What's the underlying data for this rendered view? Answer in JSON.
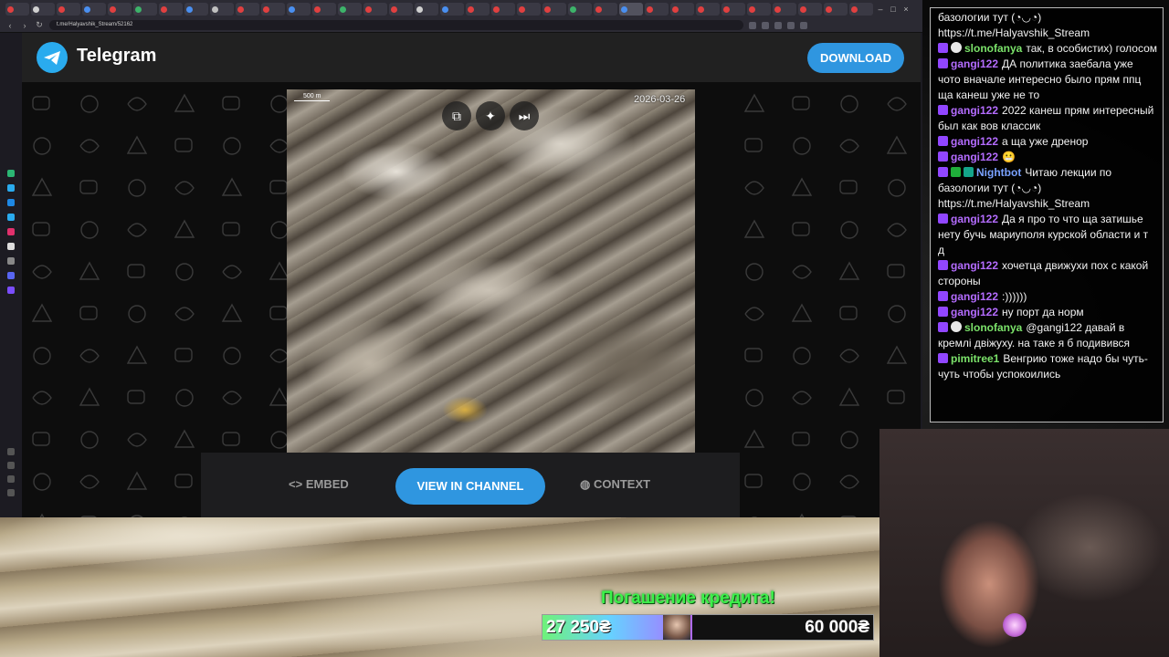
{
  "browser": {
    "url": "t.me/Halyavshik_Stream/52162",
    "tab_colors": [
      "#e04040",
      "#d0d0d0",
      "#e04040",
      "#4a8ff0",
      "#e04040",
      "#3db36a",
      "#e04040",
      "#4a8ff0",
      "#c0c0c0",
      "#e04040",
      "#e04040",
      "#4a8ff0",
      "#e04040",
      "#3db36a",
      "#e04040",
      "#e04040",
      "#d0d0d0",
      "#4a8ff0",
      "#e04040",
      "#e04040",
      "#e04040",
      "#e04040",
      "#3db36a",
      "#e04040",
      "#4a8ff0",
      "#e04040",
      "#e04040",
      "#e04040",
      "#e04040",
      "#e04040",
      "#e04040",
      "#e04040",
      "#e04040",
      "#e04040"
    ]
  },
  "telegram": {
    "title": "Telegram",
    "download_label": "DOWNLOAD",
    "accent": "#2f96e0",
    "media": {
      "scale_label": "500 m",
      "date": "2026-03-26",
      "buttons": [
        "copy-icon",
        "sparkle-icon",
        "skip-icon"
      ]
    },
    "actions": {
      "embed": "EMBED",
      "view": "VIEW IN CHANNEL",
      "context": "CONTEXT"
    }
  },
  "chat": {
    "messages": [
      {
        "user": "",
        "color": "#f2f2f2",
        "badges": [],
        "text": "базологии тут (◔◡◔)",
        "cont": true
      },
      {
        "user": "",
        "color": "#f2f2f2",
        "badges": [],
        "text": "https://t.me/Halyavshik_Stream",
        "cont": true
      },
      {
        "user": "slonofanya",
        "color": "#7be26a",
        "badges": [
          "purple",
          "skull"
        ],
        "text": "так, в особистих) голосом"
      },
      {
        "user": "gangi122",
        "color": "#b46cff",
        "badges": [
          "purple"
        ],
        "text": "ДА политика заебала уже чото вначале интересно было прям ппц ща канеш уже не то"
      },
      {
        "user": "gangi122",
        "color": "#b46cff",
        "badges": [
          "purple"
        ],
        "text": "2022 канеш прям интересный был как вов классик"
      },
      {
        "user": "gangi122",
        "color": "#b46cff",
        "badges": [
          "purple"
        ],
        "text": "а ща уже дренор"
      },
      {
        "user": "gangi122",
        "color": "#b46cff",
        "badges": [
          "purple"
        ],
        "text": "😬"
      },
      {
        "user": "Nightbot",
        "color": "#7aa2ff",
        "badges": [
          "purple",
          "green",
          "teal"
        ],
        "text": "Читаю лекции по базологии тут (◔◡◔) https://t.me/Halyavshik_Stream"
      },
      {
        "user": "gangi122",
        "color": "#b46cff",
        "badges": [
          "purple"
        ],
        "text": "Да я про то что ща затишье нету бучь мариуполя курской области и т д"
      },
      {
        "user": "gangi122",
        "color": "#b46cff",
        "badges": [
          "purple"
        ],
        "text": "хочетца движухи пох с какой стороны"
      },
      {
        "user": "gangi122",
        "color": "#b46cff",
        "badges": [
          "purple"
        ],
        "text": ":))))))"
      },
      {
        "user": "gangi122",
        "color": "#b46cff",
        "badges": [
          "purple"
        ],
        "text": "ну порт да норм"
      },
      {
        "user": "slonofanya",
        "color": "#7be26a",
        "badges": [
          "purple",
          "skull"
        ],
        "text": "@gangi122 давай в кремлі двіжуху. на таке я б подивився"
      },
      {
        "user": "pimitree1",
        "color": "#7be26a",
        "badges": [
          "purple"
        ],
        "text": "Венгрию тоже надо бы чуть-чуть чтобы успокоились"
      }
    ]
  },
  "credit": {
    "title": "Погашение кредита!",
    "current": "27 250₴",
    "goal": "60 000₴",
    "progress": 0.454
  }
}
